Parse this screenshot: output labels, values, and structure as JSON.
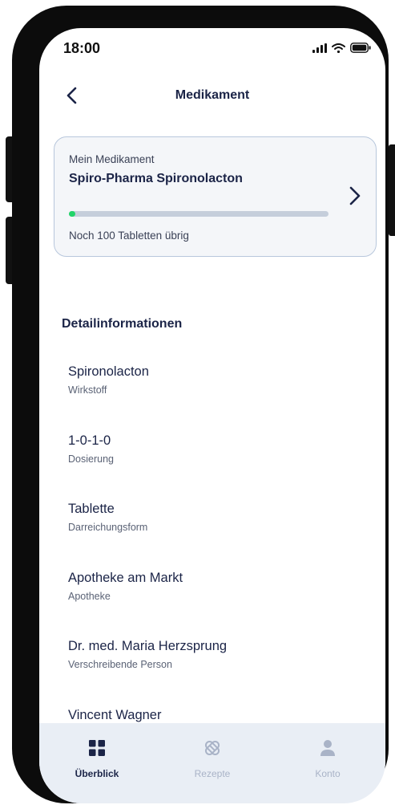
{
  "status_bar": {
    "time": "18:00"
  },
  "header": {
    "title": "Medikament"
  },
  "med_card": {
    "label": "Mein Medikament",
    "name": "Spiro-Pharma Spironolacton",
    "remaining_text": "Noch 100 Tabletten übrig",
    "progress_fraction": 0.02
  },
  "details": {
    "title": "Detailinformationen",
    "items": [
      {
        "value": "Spironolacton",
        "label": "Wirkstoff"
      },
      {
        "value": "1-0-1-0",
        "label": "Dosierung"
      },
      {
        "value": "Tablette",
        "label": "Darreichungsform"
      },
      {
        "value": "Apotheke am Markt",
        "label": "Apotheke"
      },
      {
        "value": "Dr. med. Maria Herzsprung",
        "label": "Verschreibende Person"
      },
      {
        "value": "Vincent Wagner",
        "label": ""
      }
    ]
  },
  "bottom_nav": {
    "items": [
      {
        "label": "Überblick",
        "icon": "grid-icon",
        "active": true
      },
      {
        "label": "Rezepte",
        "icon": "pill-icon",
        "active": false
      },
      {
        "label": "Konto",
        "icon": "person-icon",
        "active": false
      }
    ]
  },
  "colors": {
    "primary": "#1b2447",
    "progress": "#22d46a",
    "card_border": "#b8c7dc",
    "nav_background": "#e9eef5",
    "nav_inactive": "#a9b3c7"
  }
}
